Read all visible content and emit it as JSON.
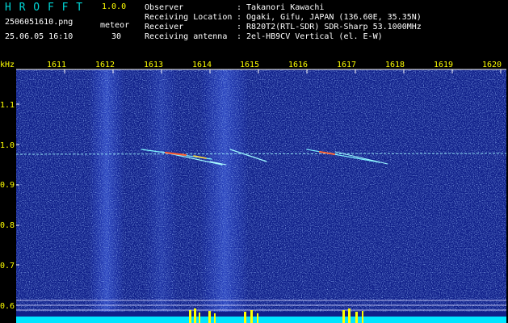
{
  "app": {
    "title": "H R O F F T",
    "version": "1.0.0"
  },
  "left": {
    "filename": "2506051610.png",
    "datetime": "25.06.05 16:10",
    "mode_label": "meteor",
    "count": "30"
  },
  "info": {
    "rows": [
      {
        "label": "Observer",
        "value": ": Takanori Kawachi"
      },
      {
        "label": "Receiving Location",
        "value": ": Ogaki, Gifu, JAPAN (136.60E, 35.35N)"
      },
      {
        "label": "Receiver",
        "value": ": R820T2(RTL-SDR) SDR-Sharp 53.1000MHz"
      },
      {
        "label": "Receiving antenna",
        "value": ": 2el-HB9CV Vertical (el. E-W)"
      }
    ]
  },
  "axes": {
    "unit": "kHz",
    "time_ticks": [
      "1611",
      "1612",
      "1613",
      "1614",
      "1615",
      "1616",
      "1617",
      "1618",
      "1619",
      "1620"
    ],
    "freq_ticks": [
      "1.1",
      "1.0",
      "0.9",
      "0.8",
      "0.7",
      "0.6"
    ]
  },
  "colors": {
    "label_cyan": "#00d7d7",
    "label_yellow": "#ffff00",
    "background": "#10208a",
    "baseline": "#00e5ff",
    "burst": "#ffff00"
  }
}
